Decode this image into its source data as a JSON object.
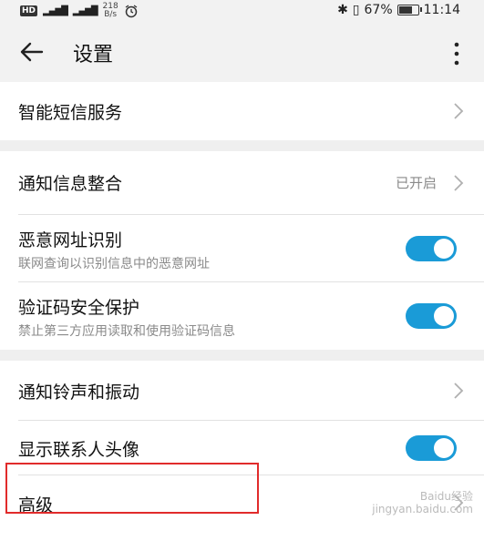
{
  "status_bar": {
    "hd": "HD",
    "speed_value": "218",
    "speed_unit": "B/s",
    "battery": "67%",
    "time": "11:14"
  },
  "app_bar": {
    "title": "设置"
  },
  "rows": [
    {
      "label": "智能短信服务"
    },
    {
      "label": "通知信息整合",
      "value": "已开启"
    },
    {
      "label": "恶意网址识别",
      "sub": "联网查询以识别信息中的恶意网址",
      "toggle_on": true
    },
    {
      "label": "验证码安全保护",
      "sub": "禁止第三方应用读取和使用验证码信息",
      "toggle_on": true
    },
    {
      "label": "通知铃声和振动"
    },
    {
      "label": "显示联系人头像",
      "toggle_on": true
    },
    {
      "label": "高级"
    }
  ],
  "watermark": {
    "line1": "Baidu经验",
    "line2": "jingyan.baidu.com"
  },
  "colors": {
    "toggle_on": "#1a9bd7",
    "highlight_border": "#e12b2b"
  }
}
